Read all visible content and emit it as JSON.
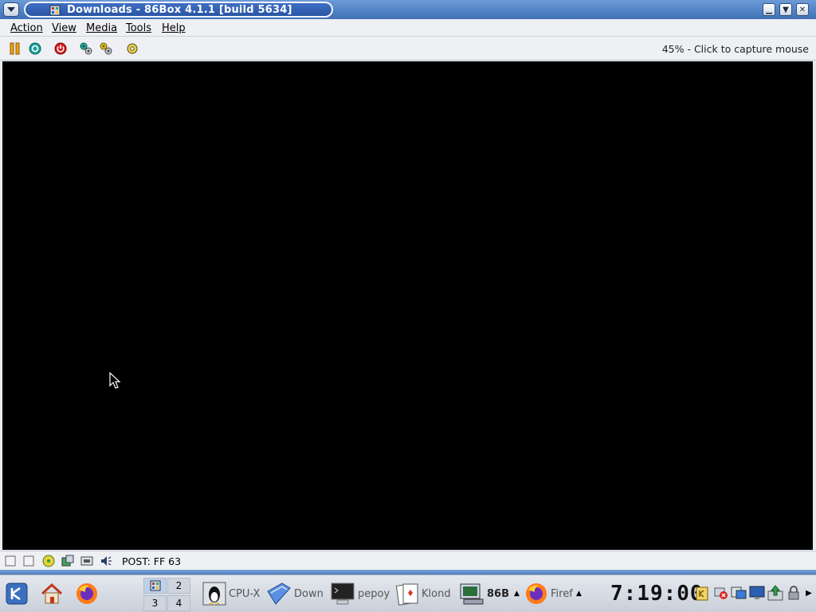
{
  "window": {
    "title": "Downloads - 86Box 4.1.1 [build 5634]"
  },
  "menubar": {
    "items": [
      "Action",
      "View",
      "Media",
      "Tools",
      "Help"
    ]
  },
  "toolbar": {
    "status_right": "45% - Click to capture mouse"
  },
  "statusbar": {
    "post_text": "POST: FF 63"
  },
  "taskbar": {
    "pager": [
      "2",
      "3",
      "4"
    ],
    "tasks": [
      {
        "label": "CPU-X",
        "icon": "tux-icon"
      },
      {
        "label": "Down",
        "icon": "folder-icon"
      },
      {
        "label": "pepoy",
        "icon": "terminal-icon"
      },
      {
        "label": "Klond",
        "icon": "cards-icon"
      },
      {
        "label": "86B",
        "icon": "86box-icon"
      },
      {
        "label": "Firef",
        "icon": "firefox-icon"
      }
    ],
    "clock": "7:19:00"
  },
  "colors": {
    "titlebar": "#3f6fb6",
    "screen": "#000000",
    "chrome": "#eef0f3"
  }
}
